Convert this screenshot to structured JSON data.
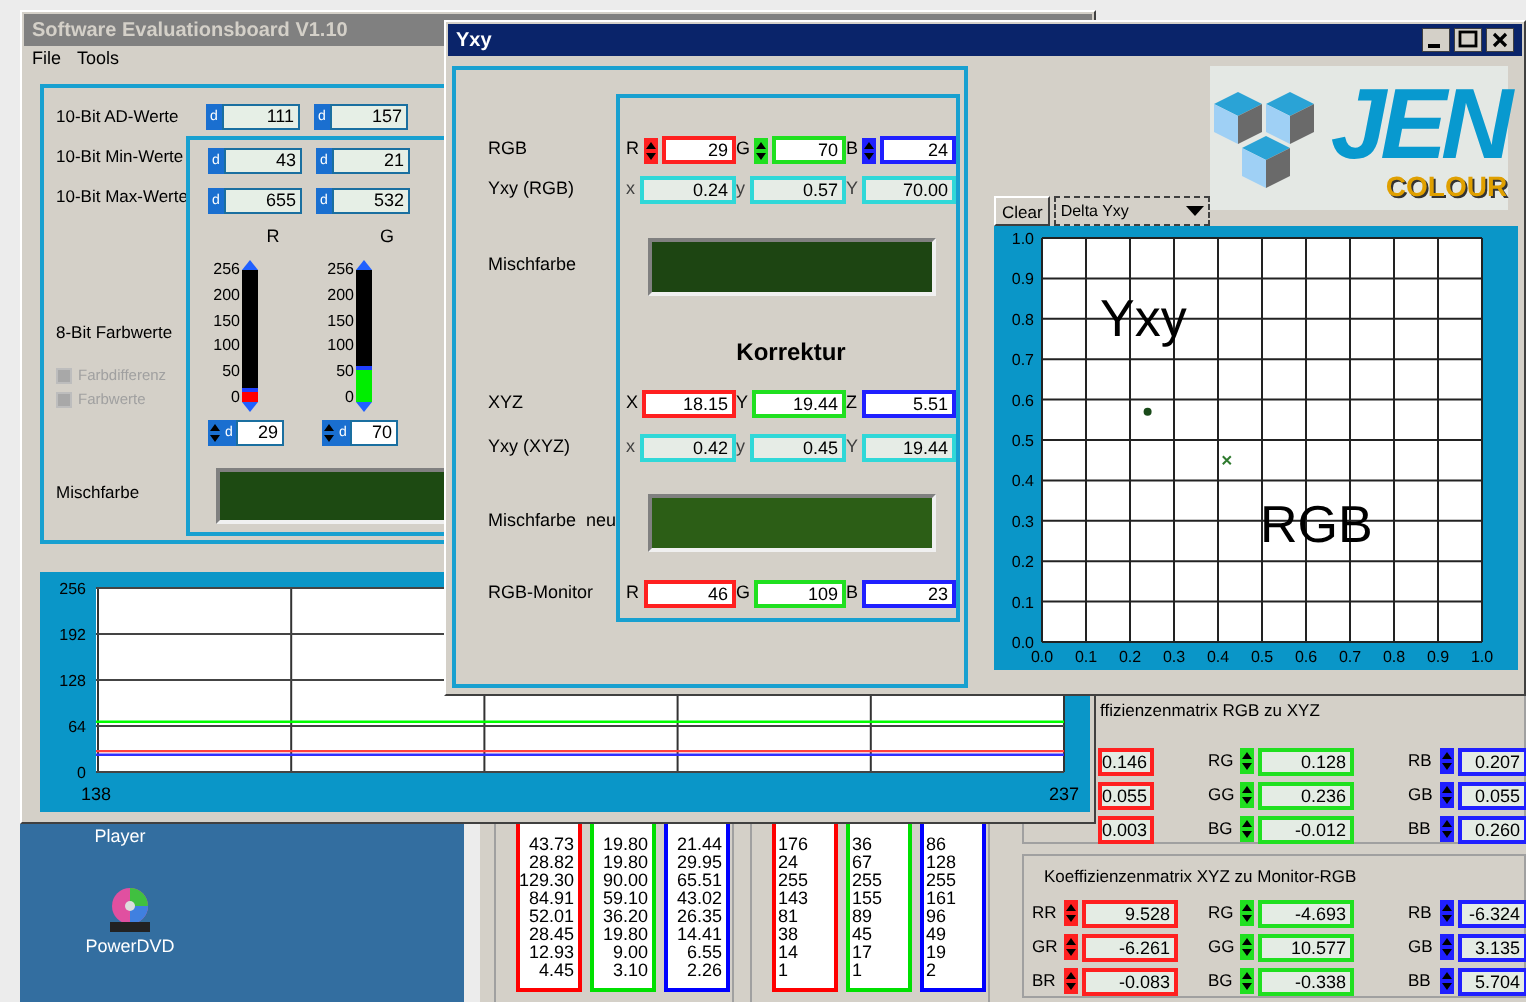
{
  "desktop": {
    "icons": [
      {
        "label": "Player",
        "kind": "label_only"
      },
      {
        "label": "PowerDVD",
        "kind": "disc"
      }
    ]
  },
  "background_window": {
    "lists": [
      [
        {
          "color": "#ff0000",
          "values": [
            "43.73",
            "28.82",
            "129.30",
            "84.91",
            "52.01",
            "28.45",
            "12.93",
            "4.45"
          ]
        },
        {
          "color": "#00e000",
          "values": [
            "19.80",
            "19.80",
            "90.00",
            "59.10",
            "36.20",
            "19.80",
            "9.00",
            "3.10"
          ]
        },
        {
          "color": "#0000ff",
          "values": [
            "21.44",
            "29.95",
            "65.51",
            "43.02",
            "26.35",
            "14.41",
            "6.55",
            "2.26"
          ]
        }
      ],
      [
        {
          "color": "#ff0000",
          "values": [
            "176",
            "24",
            "255",
            "143",
            "81",
            "38",
            "14",
            "1"
          ]
        },
        {
          "color": "#00e000",
          "values": [
            "36",
            "67",
            "255",
            "155",
            "89",
            "45",
            "17",
            "1"
          ]
        },
        {
          "color": "#0000ff",
          "values": [
            "86",
            "128",
            "255",
            "161",
            "96",
            "49",
            "19",
            "2"
          ]
        }
      ]
    ],
    "matrices": [
      {
        "title": "ffizienzenmatrix RGB zu XYZ",
        "columns": [
          {
            "color": "#ff2020",
            "cells": [
              {
                "value": "0.146"
              },
              {
                "value": "0.055"
              },
              {
                "value": "0.003"
              }
            ]
          },
          {
            "color": "#20e020",
            "cells": [
              {
                "label": "RG",
                "value": "0.128"
              },
              {
                "label": "GG",
                "value": "0.236"
              },
              {
                "label": "BG",
                "value": "-0.012"
              }
            ]
          },
          {
            "color": "#2020ff",
            "cells": [
              {
                "label": "RB",
                "value": "0.207"
              },
              {
                "label": "GB",
                "value": "0.055"
              },
              {
                "label": "BB",
                "value": "0.260"
              }
            ]
          }
        ]
      },
      {
        "title": "Koeffizienzenmatrix XYZ zu Monitor-RGB",
        "columns": [
          {
            "color": "#ff2020",
            "cells": [
              {
                "label": "RR",
                "value": "9.528"
              },
              {
                "label": "GR",
                "value": "-6.261"
              },
              {
                "label": "BR",
                "value": "-0.083"
              }
            ]
          },
          {
            "color": "#20e020",
            "cells": [
              {
                "label": "RG",
                "value": "-4.693"
              },
              {
                "label": "GG",
                "value": "10.577"
              },
              {
                "label": "BG",
                "value": "-0.338"
              }
            ]
          },
          {
            "color": "#2020ff",
            "cells": [
              {
                "label": "RB",
                "value": "-6.324"
              },
              {
                "label": "GB",
                "value": "3.135"
              },
              {
                "label": "BB",
                "value": "5.704"
              }
            ]
          }
        ]
      }
    ]
  },
  "main_window": {
    "title": "Software Evaluationsboard V1.10",
    "active": false,
    "menu": [
      "File",
      "Tools"
    ],
    "rows": [
      {
        "label": "10-Bit AD-Werte",
        "fields": [
          {
            "prefix": "d",
            "value": "111"
          },
          {
            "prefix": "d",
            "value": "157"
          }
        ]
      },
      {
        "label": "10-Bit Min-Werte",
        "fields": [
          {
            "prefix": "d",
            "value": "43"
          },
          {
            "prefix": "d",
            "value": "21"
          }
        ]
      },
      {
        "label": "10-Bit Max-Werte",
        "fields": [
          {
            "prefix": "d",
            "value": "655"
          },
          {
            "prefix": "d",
            "value": "532"
          }
        ]
      }
    ],
    "channels_label": "8-Bit Farbwerte",
    "channels": [
      {
        "name": "R",
        "color": "#ff0000",
        "level": 0.113,
        "scale": [
          "256",
          "200",
          "150",
          "100",
          "50",
          "0"
        ],
        "prefix": "d",
        "value": "29"
      },
      {
        "name": "G",
        "color": "#00ee00",
        "level": 0.273,
        "scale": [
          "256",
          "200",
          "150",
          "100",
          "50",
          "0"
        ],
        "prefix": "d",
        "value": "70"
      }
    ],
    "options": [
      {
        "label": "Farbdifferenz",
        "disabled": true
      },
      {
        "label": "Farbwerte",
        "disabled": true
      }
    ],
    "mix": {
      "label": "Mischfarbe",
      "color": "#1d4a12"
    },
    "chart_data": {
      "type": "line",
      "x": [
        138,
        237
      ],
      "xlim": [
        138,
        237
      ],
      "xticks": [
        138,
        237
      ],
      "ylim": [
        0,
        256
      ],
      "yticks": [
        0,
        64,
        128,
        192,
        256
      ],
      "grid": true,
      "series": [
        {
          "color": "#ff4040",
          "values": [
            29,
            29
          ]
        },
        {
          "color": "#00ff00",
          "values": [
            70,
            70
          ]
        },
        {
          "color": "#3030ff",
          "values": [
            24,
            24
          ]
        }
      ]
    }
  },
  "yxy_window": {
    "title": "Yxy",
    "active": true,
    "rows": [
      {
        "kind": "fields",
        "label": "RGB",
        "fields": [
          {
            "kind": "spin",
            "prefix": "R",
            "value": "29",
            "color": "#ff2020"
          },
          {
            "kind": "spin",
            "prefix": "G",
            "value": "70",
            "color": "#20e020"
          },
          {
            "kind": "spin",
            "prefix": "B",
            "value": "24",
            "color": "#2020ff"
          }
        ]
      },
      {
        "kind": "fields",
        "label": "Yxy (RGB)",
        "fields": [
          {
            "kind": "readout",
            "prefix": "x",
            "value": "0.24",
            "color": "#30d8d8"
          },
          {
            "kind": "readout",
            "prefix": "y",
            "value": "0.57",
            "color": "#30d8d8"
          },
          {
            "kind": "readout",
            "prefix": "Y",
            "value": "70.00",
            "color": "#30d8d8"
          }
        ]
      },
      {
        "kind": "swatch",
        "label": "Mischfarbe",
        "color": "#1d4512"
      },
      {
        "kind": "heading",
        "text": "Korrektur"
      },
      {
        "kind": "fields",
        "label": "XYZ",
        "fields": [
          {
            "kind": "plain",
            "prefix": "X",
            "value": "18.15",
            "color": "#ff2020"
          },
          {
            "kind": "plain",
            "prefix": "Y",
            "value": "19.44",
            "color": "#20e020"
          },
          {
            "kind": "plain",
            "prefix": "Z",
            "value": "5.51",
            "color": "#2020ff"
          }
        ]
      },
      {
        "kind": "fields",
        "label": "Yxy (XYZ)",
        "fields": [
          {
            "kind": "readout",
            "prefix": "x",
            "value": "0.42",
            "color": "#30d8d8"
          },
          {
            "kind": "readout",
            "prefix": "y",
            "value": "0.45",
            "color": "#30d8d8"
          },
          {
            "kind": "readout",
            "prefix": "Y",
            "value": "19.44",
            "color": "#30d8d8"
          }
        ]
      },
      {
        "kind": "swatch",
        "label": "Mischfarbe  neu",
        "color": "#2c5e16"
      },
      {
        "kind": "fields",
        "label": "RGB-Monitor",
        "fields": [
          {
            "kind": "plain",
            "prefix": "R",
            "value": "46",
            "color": "#ff2020"
          },
          {
            "kind": "plain",
            "prefix": "G",
            "value": "109",
            "color": "#20e020"
          },
          {
            "kind": "plain",
            "prefix": "B",
            "value": "23",
            "color": "#2020ff"
          }
        ]
      }
    ],
    "logo": {
      "text": "JEN",
      "subtext": "COLOUR"
    },
    "clear_button": "Clear",
    "mode_select": {
      "value": "Delta Yxy"
    },
    "chart_data": {
      "type": "scatter",
      "xlim": [
        0,
        1
      ],
      "ylim": [
        0,
        1
      ],
      "grid": true,
      "xticks": [
        {
          "value": 0,
          "label": "0.0"
        },
        {
          "value": 0.1,
          "label": "0.1"
        },
        {
          "value": 0.2,
          "label": "0.2"
        },
        {
          "value": 0.3,
          "label": "0.3"
        },
        {
          "value": 0.4,
          "label": "0.4"
        },
        {
          "value": 0.5,
          "label": "0.5"
        },
        {
          "value": 0.6,
          "label": "0.6"
        },
        {
          "value": 0.7,
          "label": "0.7"
        },
        {
          "value": 0.8,
          "label": "0.8"
        },
        {
          "value": 0.9,
          "label": "0.9"
        },
        {
          "value": 1,
          "label": "1.0"
        }
      ],
      "yticks": [
        {
          "value": 0,
          "label": "0.0"
        },
        {
          "value": 0.1,
          "label": "0.1"
        },
        {
          "value": 0.2,
          "label": "0.2"
        },
        {
          "value": 0.3,
          "label": "0.3"
        },
        {
          "value": 0.4,
          "label": "0.4"
        },
        {
          "value": 0.5,
          "label": "0.5"
        },
        {
          "value": 0.6,
          "label": "0.6"
        },
        {
          "value": 0.7,
          "label": "0.7"
        },
        {
          "value": 0.8,
          "label": "0.8"
        },
        {
          "value": 0.9,
          "label": "0.9"
        },
        {
          "value": 1,
          "label": "1.0"
        }
      ],
      "series": [
        {
          "marker": "dot",
          "color": "#1a4a1a",
          "x": [
            0.24
          ],
          "values": [
            0.57
          ]
        },
        {
          "marker": "cross",
          "color": "#2e7a2e",
          "x": [
            0.42
          ],
          "values": [
            0.45
          ]
        }
      ],
      "annotations": [
        "Yxy",
        "RGB"
      ]
    }
  }
}
